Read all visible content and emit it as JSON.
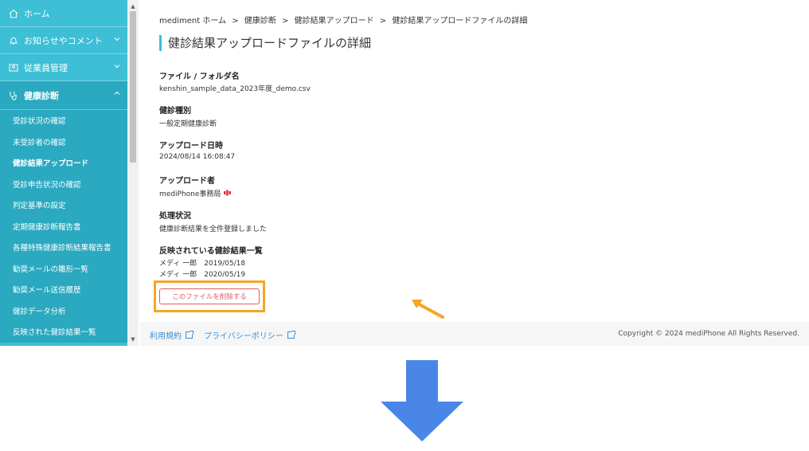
{
  "sidebar": {
    "items": [
      {
        "label": "ホーム",
        "icon": "home-icon"
      },
      {
        "label": "お知らせやコメント",
        "icon": "bell-icon"
      },
      {
        "label": "従業員管理",
        "icon": "users-icon"
      },
      {
        "label": "健康診断",
        "icon": "stethoscope-icon"
      }
    ],
    "subitems": [
      "受診状況の確認",
      "未受診者の確認",
      "健診結果アップロード",
      "受診申告状況の確認",
      "判定基準の設定",
      "定期健康診断報告書",
      "各種特殊健康診断結果報告書",
      "勧奨メールの雛形一覧",
      "勧奨メール送信履歴",
      "健診データ分析",
      "反映された健診結果一覧"
    ]
  },
  "breadcrumb": {
    "home": "mediment ホーム",
    "sep": ">",
    "c1": "健康診断",
    "c2": "健診結果アップロード",
    "c3": "健診結果アップロードファイルの詳細"
  },
  "page": {
    "title": "健診結果アップロードファイルの詳細"
  },
  "fields": {
    "file_label": "ファイル / フォルダ名",
    "file_value": "kenshin_sample_data_2023年度_demo.csv",
    "type_label": "健診種別",
    "type_value": "一般定期健康診断",
    "date_label": "アップロード日時",
    "date_value": "2024/08/14 16:08:47",
    "uploader_label": "アップロード者",
    "uploader_value": "mediPhone事務局",
    "status_label": "処理状況",
    "status_value": "健康診断結果を全件登録しました",
    "reflected_label": "反映されている健診結果一覧",
    "reflected": [
      "メディ 一郎　2019/05/18",
      "メディ 一郎　2020/05/19"
    ]
  },
  "actions": {
    "delete_label": "このファイルを削除する"
  },
  "footer": {
    "terms": "利用規約",
    "privacy": "プライバシーポリシー",
    "copyright": "Copyright © 2024 mediPhone All Rights Reserved."
  },
  "colors": {
    "sidebar": "#3dbfd6",
    "sidebar_active": "#2aa9c0",
    "highlight": "#f5a623",
    "danger": "#e05a5a",
    "big_arrow": "#4a86e8",
    "link": "#3a8ed6"
  }
}
